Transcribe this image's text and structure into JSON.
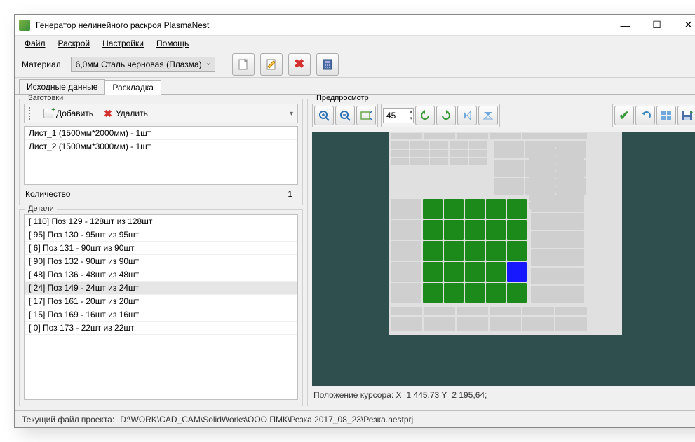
{
  "title": "Генератор нелинейного раскроя PlasmaNest",
  "menu": {
    "file": "Файл",
    "cut": "Раскрой",
    "settings": "Настройки",
    "help": "Помощь"
  },
  "material": {
    "label": "Материал",
    "value": "6,0мм Сталь черновая (Плазма)"
  },
  "tabs": {
    "source": "Исходные данные",
    "layout": "Раскладка"
  },
  "blanks": {
    "legend": "Заготовки",
    "add": "Добавить",
    "del": "Удалить",
    "items": [
      "Лист_1 (1500мм*2000мм) - 1шт",
      "Лист_2 (1500мм*3000мм) - 1шт"
    ],
    "qtyLabel": "Количество",
    "qtyValue": "1"
  },
  "details": {
    "legend": "Детали",
    "items": [
      "[ 110] Поз 129 - 128шт из 128шт",
      "[  95] Поз 130 - 95шт из 95шт",
      "[   6] Поз 131 - 90шт из 90шт",
      "[  90] Поз 132 - 90шт из 90шт",
      "[  48] Поз 136 - 48шт из 48шт",
      "[  24] Поз 149 - 24шт из 24шт",
      "[  17] Поз 161 - 20шт из 20шт",
      "[  15] Поз 169 - 16шт из 16шт",
      "[   0] Поз 173 - 22шт из 22шт"
    ],
    "selected": 5
  },
  "preview": {
    "legend": "Предпросмотр",
    "angle": "45",
    "cursor": "Положение курсора: X=1 445,73 Y=2 195,64;"
  },
  "status": {
    "label": "Текущий файл проекта:",
    "path": "D:\\WORK\\CAD_CAM\\SolidWorks\\ООО ПМК\\Резка 2017_08_23\\Резка.nestprj"
  }
}
